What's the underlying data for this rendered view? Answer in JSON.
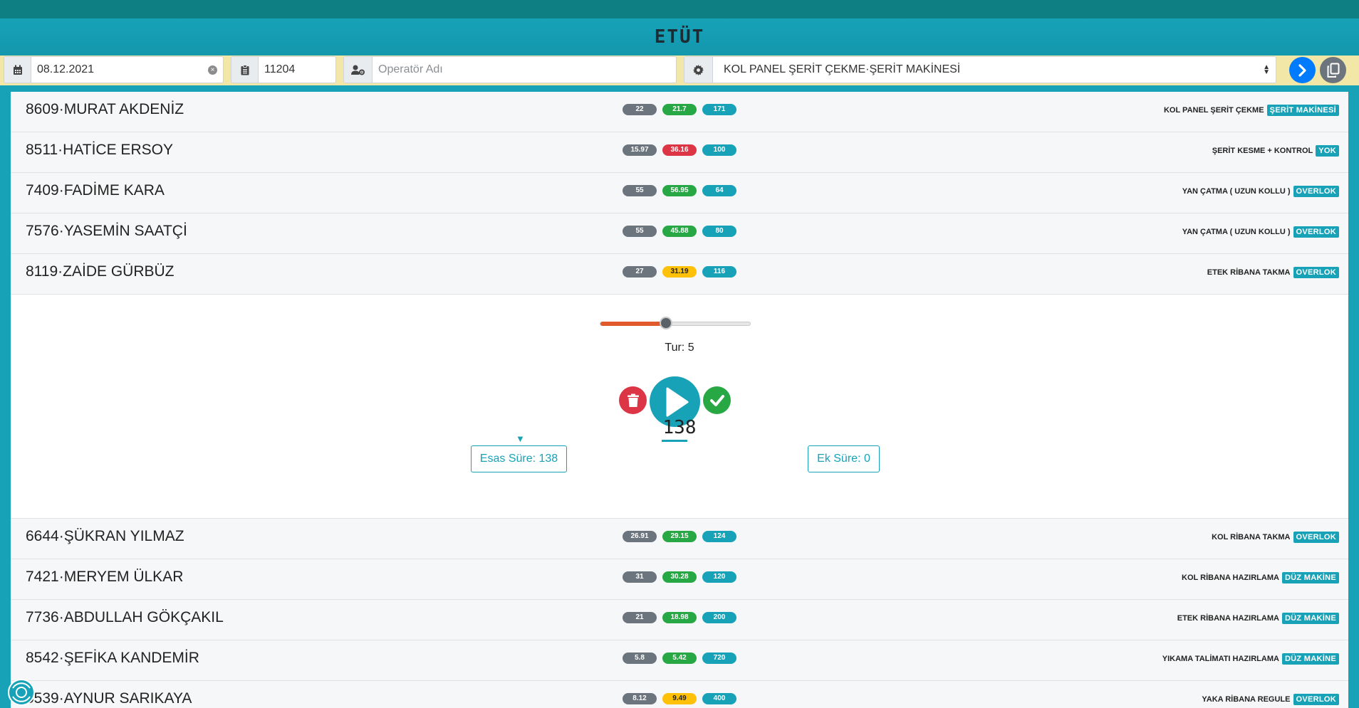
{
  "header": {
    "title": "ETÜT"
  },
  "toolbar": {
    "date_value": "08.12.2021",
    "order_value": "11204",
    "operator_placeholder": "Operatör Adı",
    "operation_select": "KOL PANEL ŞERİT ÇEKME·ŞERİT MAKİNESİ"
  },
  "rows_top": [
    {
      "name": "8609·MURAT AKDENİZ",
      "v1": "22",
      "v2": "21.7",
      "v2_color": "green",
      "v3": "171",
      "task": "KOL PANEL ŞERİT ÇEKME",
      "machine": "ŞERİT MAKİNESİ"
    },
    {
      "name": "8511·HATİCE ERSOY",
      "v1": "15.97",
      "v2": "36.16",
      "v2_color": "red",
      "v3": "100",
      "task": "ŞERİT KESME + KONTROL",
      "machine": "YOK"
    },
    {
      "name": "7409·FADİME KARA",
      "v1": "55",
      "v2": "56.95",
      "v2_color": "green",
      "v3": "64",
      "task": "YAN ÇATMA ( UZUN KOLLU )",
      "machine": "OVERLOK"
    },
    {
      "name": "7576·YASEMİN SAATÇİ",
      "v1": "55",
      "v2": "45.88",
      "v2_color": "green",
      "v3": "80",
      "task": "YAN ÇATMA ( UZUN KOLLU )",
      "machine": "OVERLOK"
    },
    {
      "name": "8119·ZAİDE GÜRBÜZ",
      "v1": "27",
      "v2": "31.19",
      "v2_color": "yellow",
      "v3": "116",
      "task": "ETEK RİBANA TAKMA",
      "machine": "OVERLOK"
    }
  ],
  "expanded": {
    "slider_fraction": 0.44,
    "tur_label": "Tur: 5",
    "timer": "138",
    "esas_label": "Esas Süre: 138",
    "ek_label": "Ek Süre: 0"
  },
  "rows_bottom": [
    {
      "name": "6644·ŞÜKRAN YILMAZ",
      "v1": "26.91",
      "v2": "29.15",
      "v2_color": "green",
      "v3": "124",
      "task": "KOL RİBANA TAKMA",
      "machine": "OVERLOK"
    },
    {
      "name": "7421·MERYEM ÜLKAR",
      "v1": "31",
      "v2": "30.28",
      "v2_color": "green",
      "v3": "120",
      "task": "KOL RİBANA HAZIRLAMA",
      "machine": "DÜZ MAKİNE"
    },
    {
      "name": "7736·ABDULLAH GÖKÇAKIL",
      "v1": "21",
      "v2": "18.98",
      "v2_color": "green",
      "v3": "200",
      "task": "ETEK RİBANA HAZIRLAMA",
      "machine": "DÜZ MAKİNE"
    },
    {
      "name": "8542·ŞEFİKA KANDEMİR",
      "v1": "5.8",
      "v2": "5.42",
      "v2_color": "green",
      "v3": "720",
      "task": "YIKAMA TALİMATI HAZIRLAMA",
      "machine": "DÜZ MAKİNE"
    },
    {
      "name": "5539·AYNUR SARIKAYA",
      "v1": "8.12",
      "v2": "9.49",
      "v2_color": "yellow",
      "v3": "400",
      "task": "YAKA RİBANA REGULE",
      "machine": "OVERLOK"
    }
  ],
  "colors": {
    "accent": "#17a2b8",
    "toolbar_bg": "#f2e7a6",
    "green": "#28a745",
    "red": "#dc3545",
    "yellow": "#ffc107",
    "gray": "#6c757d",
    "slider_fill": "#e05a2b",
    "primary": "#007bff"
  },
  "icons": {
    "date": "calendar-icon",
    "order": "clipboard-icon",
    "operator": "user-cog-icon",
    "operation": "gear-icon",
    "next": "chevron-right-icon",
    "copy": "copy-icon",
    "delete": "trash-icon",
    "play": "play-icon",
    "confirm": "check-icon"
  }
}
